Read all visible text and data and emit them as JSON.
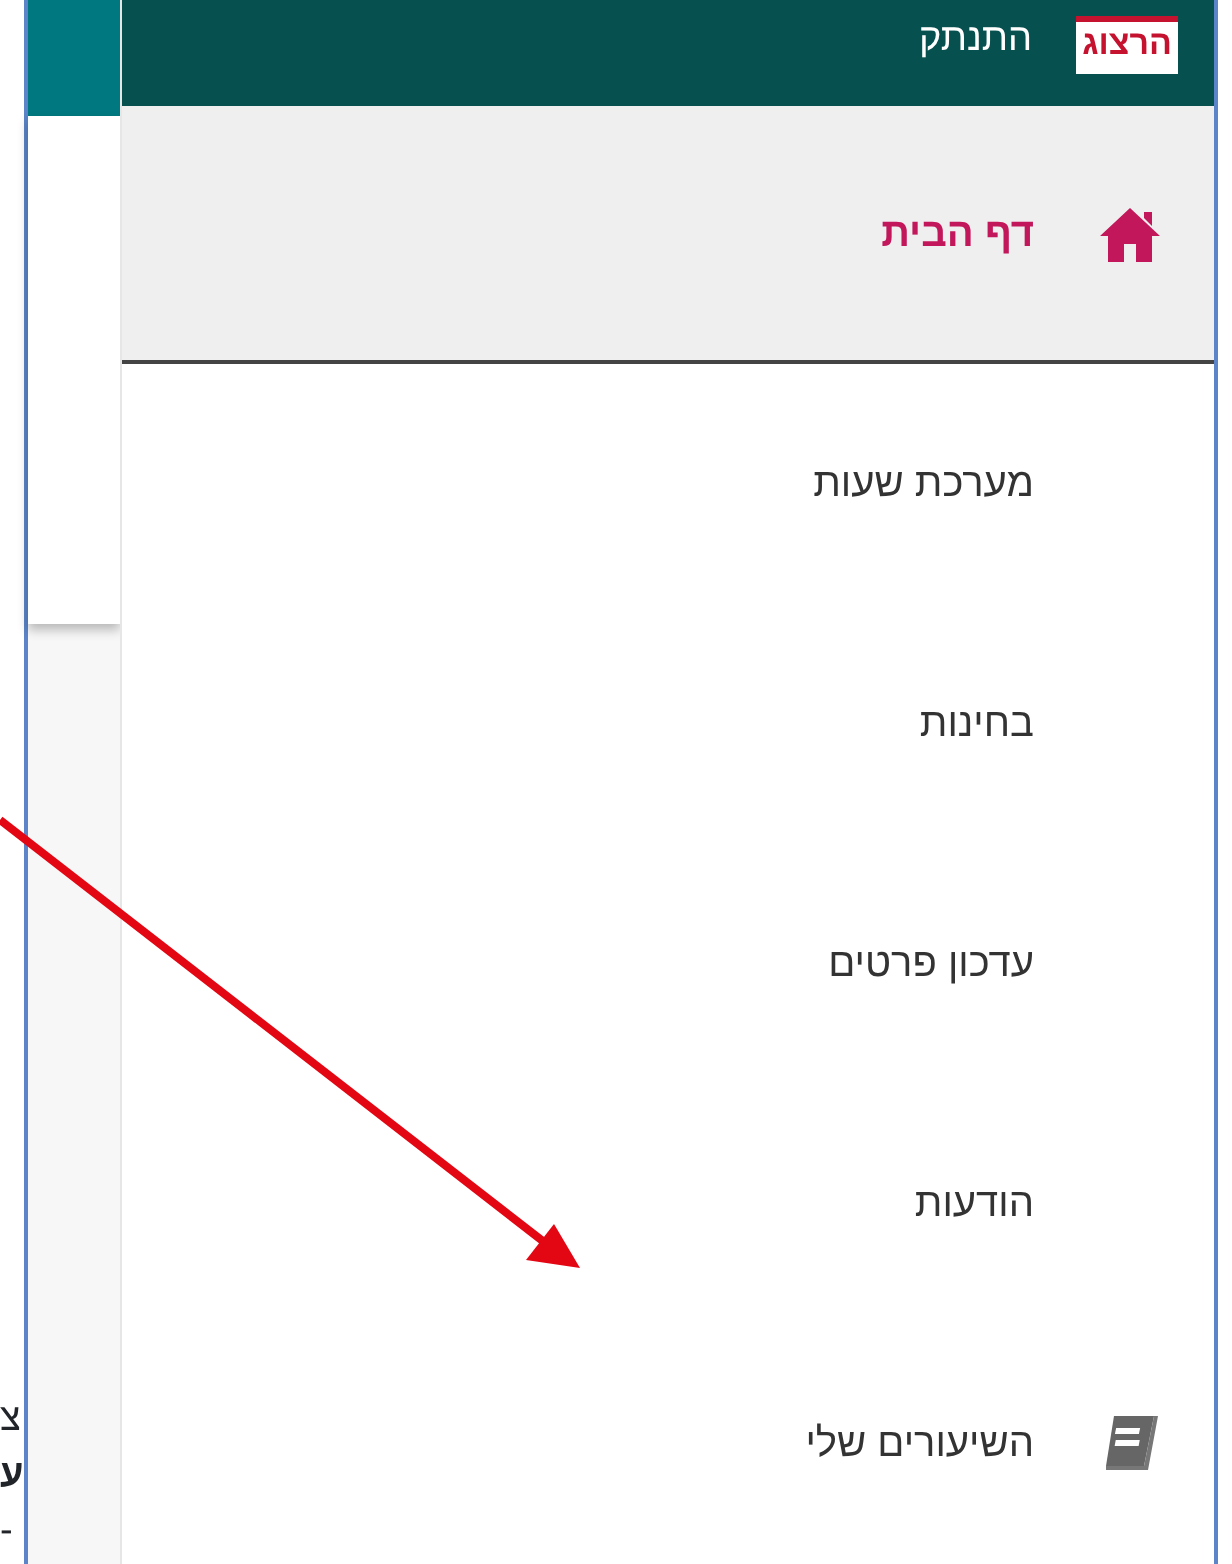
{
  "header": {
    "logo_text": "הרצוג",
    "logout": "התנתק"
  },
  "menu": [
    {
      "label": "דף הבית",
      "selected": true,
      "kind": "home"
    },
    {
      "label": "מערכת שעות",
      "selected": false
    },
    {
      "label": "בחינות",
      "selected": false
    },
    {
      "label": "עדכון פרטים",
      "selected": false
    },
    {
      "label": "הודעות",
      "selected": false
    },
    {
      "label": "השיעורים שלי",
      "selected": false,
      "kind": "book"
    }
  ],
  "outside_text": [
    {
      "text": "צ",
      "bold": false
    },
    {
      "text": "ע",
      "bold": true
    },
    {
      "text": "-",
      "bold": false
    }
  ]
}
